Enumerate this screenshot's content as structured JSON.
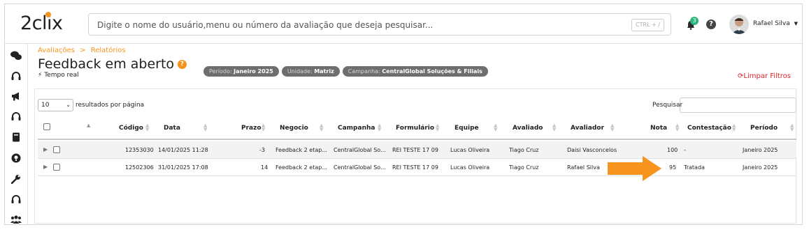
{
  "header": {
    "logo_text": "2clix",
    "search_placeholder": "Digite o nome do usuário,menu ou número da avaliação que deseja pesquisar...",
    "shortcut": "CTRL + /",
    "notifications_count": "3",
    "help_label": "?",
    "user_name": "Rafael Silva"
  },
  "sidebar": {
    "icons": [
      "chat-icon",
      "headset-icon",
      "megaphone-icon",
      "headset-icon",
      "book-icon",
      "lightbulb-icon",
      "wrench-icon",
      "headset-icon",
      "users-icon"
    ]
  },
  "page": {
    "breadcrumb_parent": "Avaliações",
    "breadcrumb_sep": ">",
    "breadcrumb_current": "Relatórios",
    "title": "Feedback em aberto",
    "title_badge": "?",
    "realtime_label": "Tempo real",
    "filters": [
      {
        "label": "Período:",
        "value": "Janeiro 2025"
      },
      {
        "label": "Unidade:",
        "value": "Matriz"
      },
      {
        "label": "Campanha:",
        "value": "CentralGlobal Soluções & Filiais"
      }
    ],
    "clear_filters": "Limpar Filtros"
  },
  "table_controls": {
    "page_size": "10",
    "per_page_label": "resultados por página",
    "search_label": "Pesquisar"
  },
  "table": {
    "columns": [
      "Código",
      "Data",
      "Prazo",
      "Negocio",
      "Campanha",
      "Formulário",
      "Equipe",
      "Avaliado",
      "Avaliador",
      "Nota",
      "Contestação",
      "Período"
    ],
    "rows": [
      {
        "codigo": "12353030",
        "data": "14/01/2025 11:28",
        "prazo": "-3",
        "negocio": "Feedback 2 etap...",
        "campanha": "CentralGlobal So...",
        "formulario": "REI TESTE 17 09",
        "equipe": "Lucas Oliveira",
        "avaliado": "Tiago Cruz",
        "avaliador": "Daisi Vasconcelos",
        "nota": "100",
        "contestacao": "-",
        "periodo": "Janeiro 2025"
      },
      {
        "codigo": "12502306",
        "data": "31/01/2025 17:08",
        "prazo": "14",
        "negocio": "Feedback 2 etap...",
        "campanha": "CentralGlobal So...",
        "formulario": "REI TESTE 17 09",
        "equipe": "Lucas Oliveira",
        "avaliado": "Tiago Cruz",
        "avaliador": "Rafael Silva",
        "nota": "95",
        "contestacao": "Tratada",
        "periodo": "Janeiro 2025"
      }
    ]
  },
  "colors": {
    "accent": "#f7941d",
    "danger": "#d8262a",
    "chip": "#6e6e6e",
    "badge_green": "#2eb67d"
  }
}
